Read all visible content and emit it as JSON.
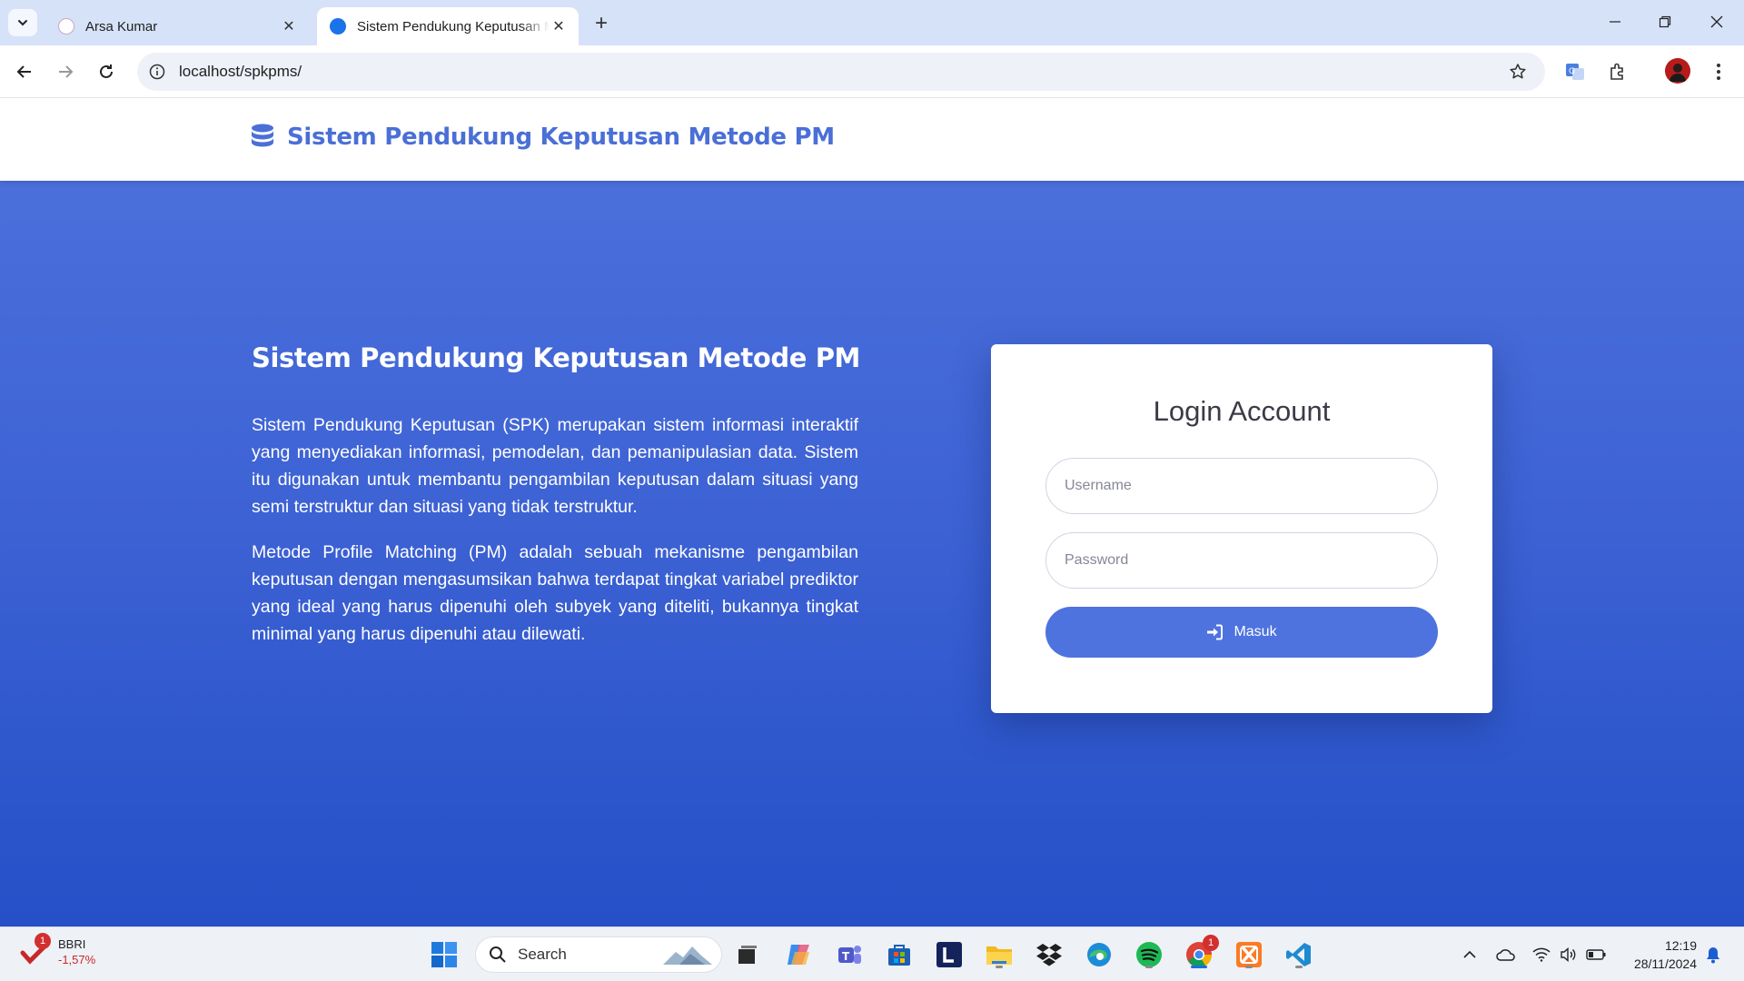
{
  "browser": {
    "tabs": [
      {
        "title": "Arsa Kumar",
        "active": false
      },
      {
        "title": "Sistem Pendukung Keputusan Metode PM",
        "active": true
      }
    ],
    "url": "localhost/spkpms/"
  },
  "navbar": {
    "brand": "Sistem Pendukung Keputusan Metode PM"
  },
  "hero": {
    "title": "Sistem Pendukung Keputusan Metode PM",
    "paragraph1": "Sistem Pendukung Keputusan (SPK) merupakan sistem informasi interaktif yang menyediakan informasi, pemodelan, dan pemanipulasian data. Sistem itu digunakan untuk membantu pengambilan keputusan dalam situasi yang semi terstruktur dan situasi yang tidak terstruktur.",
    "paragraph2": "Metode Profile Matching (PM) adalah sebuah mekanisme pengambilan keputusan dengan mengasumsikan bahwa terdapat tingkat variabel prediktor yang ideal yang harus dipenuhi oleh subyek yang diteliti, bukannya tingkat minimal yang harus dipenuhi atau dilewati."
  },
  "login": {
    "title": "Login Account",
    "username_placeholder": "Username",
    "password_placeholder": "Password",
    "submit_label": "Masuk"
  },
  "taskbar": {
    "stock": {
      "badge": "1",
      "name": "BBRI",
      "change": "-1,57%"
    },
    "search_label": "Search",
    "chrome_badge": "1",
    "time": "12:19",
    "date": "28/11/2024"
  },
  "colors": {
    "brand": "#4e73df",
    "hero_top": "#4b6fdb",
    "hero_bottom": "#2550c7"
  }
}
